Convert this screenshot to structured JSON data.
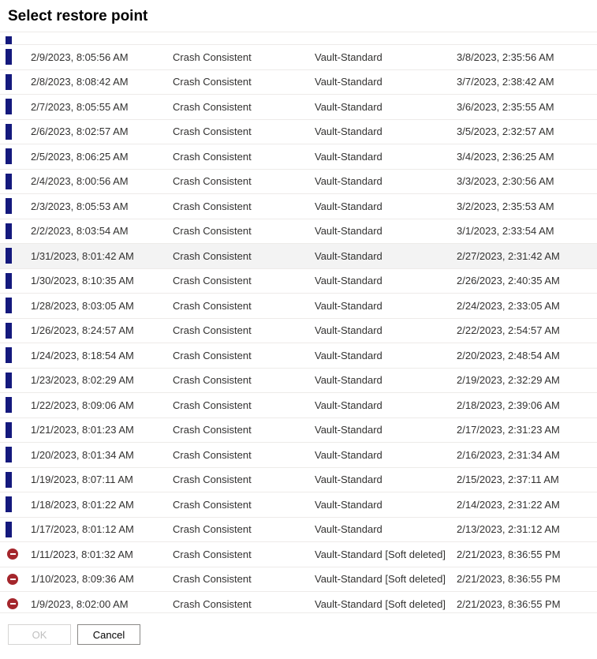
{
  "dialog": {
    "title": "Select restore point"
  },
  "rows": [
    {
      "status": "partial",
      "time": "",
      "consistency": "",
      "tier": "",
      "expiry": ""
    },
    {
      "status": "ok",
      "time": "2/9/2023, 8:05:56 AM",
      "consistency": "Crash Consistent",
      "tier": "Vault-Standard",
      "expiry": "3/8/2023, 2:35:56 AM"
    },
    {
      "status": "ok",
      "time": "2/8/2023, 8:08:42 AM",
      "consistency": "Crash Consistent",
      "tier": "Vault-Standard",
      "expiry": "3/7/2023, 2:38:42 AM"
    },
    {
      "status": "ok",
      "time": "2/7/2023, 8:05:55 AM",
      "consistency": "Crash Consistent",
      "tier": "Vault-Standard",
      "expiry": "3/6/2023, 2:35:55 AM"
    },
    {
      "status": "ok",
      "time": "2/6/2023, 8:02:57 AM",
      "consistency": "Crash Consistent",
      "tier": "Vault-Standard",
      "expiry": "3/5/2023, 2:32:57 AM"
    },
    {
      "status": "ok",
      "time": "2/5/2023, 8:06:25 AM",
      "consistency": "Crash Consistent",
      "tier": "Vault-Standard",
      "expiry": "3/4/2023, 2:36:25 AM"
    },
    {
      "status": "ok",
      "time": "2/4/2023, 8:00:56 AM",
      "consistency": "Crash Consistent",
      "tier": "Vault-Standard",
      "expiry": "3/3/2023, 2:30:56 AM"
    },
    {
      "status": "ok",
      "time": "2/3/2023, 8:05:53 AM",
      "consistency": "Crash Consistent",
      "tier": "Vault-Standard",
      "expiry": "3/2/2023, 2:35:53 AM"
    },
    {
      "status": "ok",
      "time": "2/2/2023, 8:03:54 AM",
      "consistency": "Crash Consistent",
      "tier": "Vault-Standard",
      "expiry": "3/1/2023, 2:33:54 AM"
    },
    {
      "status": "ok",
      "selected": true,
      "time": "1/31/2023, 8:01:42 AM",
      "consistency": "Crash Consistent",
      "tier": "Vault-Standard",
      "expiry": "2/27/2023, 2:31:42 AM"
    },
    {
      "status": "ok",
      "time": "1/30/2023, 8:10:35 AM",
      "consistency": "Crash Consistent",
      "tier": "Vault-Standard",
      "expiry": "2/26/2023, 2:40:35 AM"
    },
    {
      "status": "ok",
      "time": "1/28/2023, 8:03:05 AM",
      "consistency": "Crash Consistent",
      "tier": "Vault-Standard",
      "expiry": "2/24/2023, 2:33:05 AM"
    },
    {
      "status": "ok",
      "time": "1/26/2023, 8:24:57 AM",
      "consistency": "Crash Consistent",
      "tier": "Vault-Standard",
      "expiry": "2/22/2023, 2:54:57 AM"
    },
    {
      "status": "ok",
      "time": "1/24/2023, 8:18:54 AM",
      "consistency": "Crash Consistent",
      "tier": "Vault-Standard",
      "expiry": "2/20/2023, 2:48:54 AM"
    },
    {
      "status": "ok",
      "time": "1/23/2023, 8:02:29 AM",
      "consistency": "Crash Consistent",
      "tier": "Vault-Standard",
      "expiry": "2/19/2023, 2:32:29 AM"
    },
    {
      "status": "ok",
      "time": "1/22/2023, 8:09:06 AM",
      "consistency": "Crash Consistent",
      "tier": "Vault-Standard",
      "expiry": "2/18/2023, 2:39:06 AM"
    },
    {
      "status": "ok",
      "time": "1/21/2023, 8:01:23 AM",
      "consistency": "Crash Consistent",
      "tier": "Vault-Standard",
      "expiry": "2/17/2023, 2:31:23 AM"
    },
    {
      "status": "ok",
      "time": "1/20/2023, 8:01:34 AM",
      "consistency": "Crash Consistent",
      "tier": "Vault-Standard",
      "expiry": "2/16/2023, 2:31:34 AM"
    },
    {
      "status": "ok",
      "time": "1/19/2023, 8:07:11 AM",
      "consistency": "Crash Consistent",
      "tier": "Vault-Standard",
      "expiry": "2/15/2023, 2:37:11 AM"
    },
    {
      "status": "ok",
      "time": "1/18/2023, 8:01:22 AM",
      "consistency": "Crash Consistent",
      "tier": "Vault-Standard",
      "expiry": "2/14/2023, 2:31:22 AM"
    },
    {
      "status": "ok",
      "time": "1/17/2023, 8:01:12 AM",
      "consistency": "Crash Consistent",
      "tier": "Vault-Standard",
      "expiry": "2/13/2023, 2:31:12 AM"
    },
    {
      "status": "deleted",
      "time": "1/11/2023, 8:01:32 AM",
      "consistency": "Crash Consistent",
      "tier": "Vault-Standard [Soft deleted]",
      "expiry": "2/21/2023, 8:36:55 PM"
    },
    {
      "status": "deleted",
      "time": "1/10/2023, 8:09:36 AM",
      "consistency": "Crash Consistent",
      "tier": "Vault-Standard [Soft deleted]",
      "expiry": "2/21/2023, 8:36:55 PM"
    },
    {
      "status": "deleted",
      "time": "1/9/2023, 8:02:00 AM",
      "consistency": "Crash Consistent",
      "tier": "Vault-Standard [Soft deleted]",
      "expiry": "2/21/2023, 8:36:55 PM"
    }
  ],
  "footer": {
    "ok_label": "OK",
    "cancel_label": "Cancel"
  }
}
